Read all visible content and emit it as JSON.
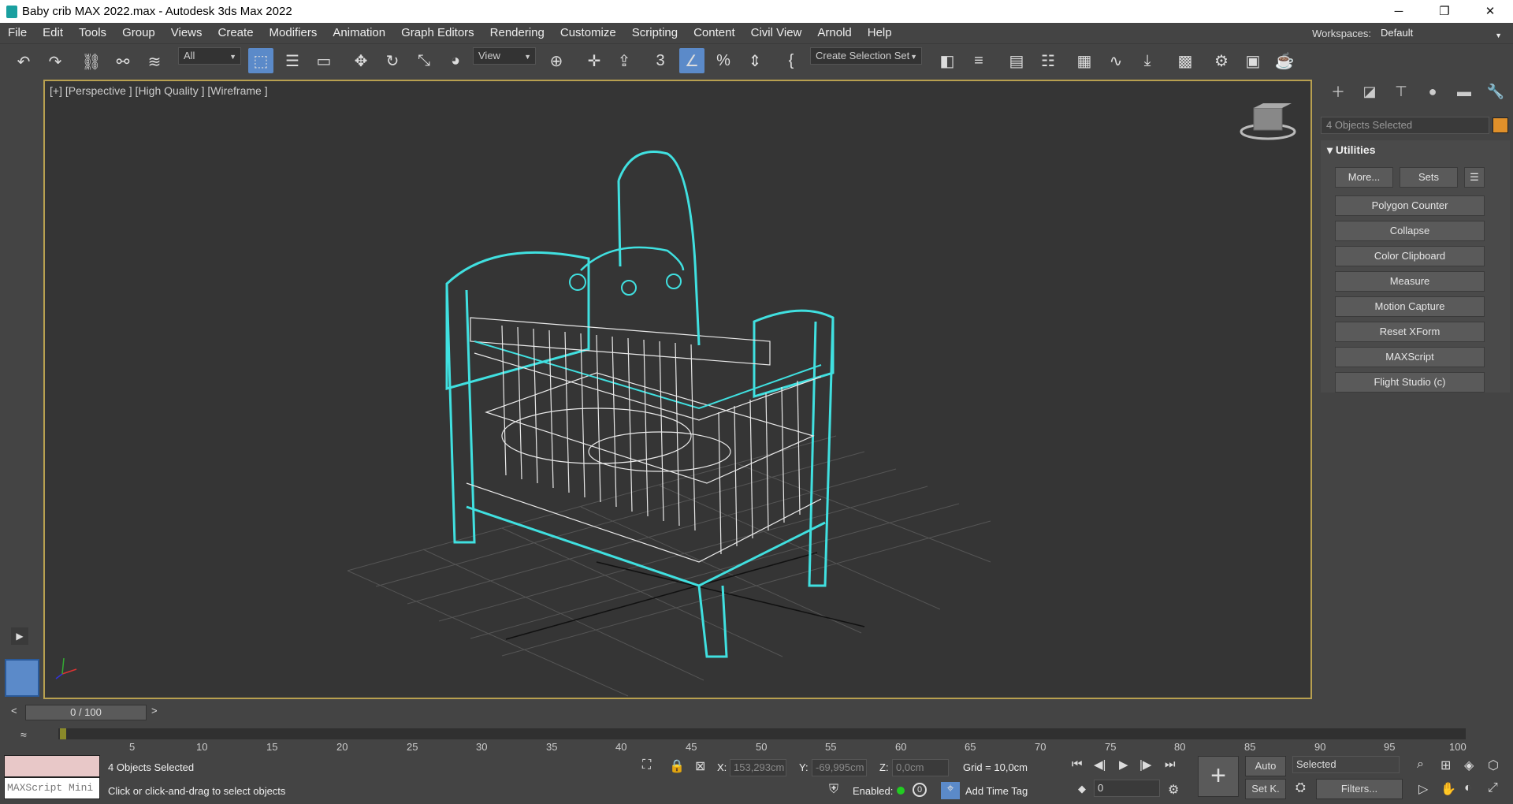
{
  "window": {
    "title": "Baby crib MAX 2022.max - Autodesk 3ds Max 2022",
    "min_icon": "minimize-icon",
    "max_icon": "restore-icon",
    "close_icon": "close-icon"
  },
  "menu": [
    "File",
    "Edit",
    "Tools",
    "Group",
    "Views",
    "Create",
    "Modifiers",
    "Animation",
    "Graph Editors",
    "Rendering",
    "Customize",
    "Scripting",
    "Content",
    "Civil View",
    "Arnold",
    "Help"
  ],
  "workspaces": {
    "label": "Workspaces:",
    "value": "Default"
  },
  "toolbar": {
    "filter_value": "All",
    "ref_coord_value": "View",
    "selection_set_value": "Create Selection Set",
    "snap_label": "3"
  },
  "viewport": {
    "label": "[+] [Perspective ] [High Quality ] [Wireframe ]"
  },
  "command_panel": {
    "selection_name": "4 Objects Selected",
    "rollout_title": "Utilities",
    "more_button": "More...",
    "sets_button": "Sets",
    "utilities": [
      "Polygon Counter",
      "Collapse",
      "Color Clipboard",
      "Measure",
      "Motion Capture",
      "Reset XForm",
      "MAXScript",
      "Flight Studio (c)"
    ]
  },
  "timeline": {
    "slider_label": "0 / 100",
    "prev": "<",
    "next": ">",
    "ticks": [
      "5",
      "10",
      "15",
      "20",
      "25",
      "30",
      "35",
      "40",
      "45",
      "50",
      "55",
      "60",
      "65",
      "70",
      "75",
      "80",
      "85",
      "90",
      "95",
      "100"
    ]
  },
  "status": {
    "maxscript_label": "MAXScript Mini",
    "selection_text": "4 Objects Selected",
    "prompt_text": "Click or click-and-drag to select objects",
    "x_label": "X:",
    "x_value": "153,293cm",
    "y_label": "Y:",
    "y_value": "-69,995cm",
    "z_label": "Z:",
    "z_value": "0,0cm",
    "grid_text": "Grid = 10,0cm",
    "enabled_label": "Enabled:",
    "add_time_tag": "Add Time Tag",
    "auto_button": "Auto",
    "setk_button": "Set K.",
    "key_mode_value": "Selected",
    "filters_button": "Filters...",
    "frame_value": "0"
  }
}
